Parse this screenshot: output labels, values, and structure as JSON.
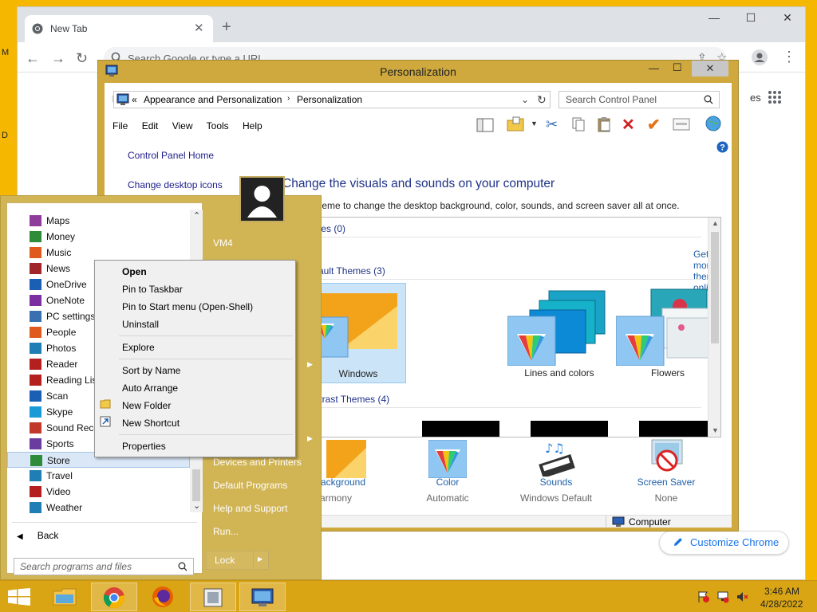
{
  "desktop": {
    "labels": [
      "M",
      "D"
    ]
  },
  "chrome": {
    "tab_title": "New Tab",
    "omnibox_placeholder": "Search Google or type a URL",
    "ntp_link_fragment": "es",
    "customize_label": "Customize Chrome"
  },
  "personalization": {
    "title": "Personalization",
    "breadcrumb": [
      "Appearance and Personalization",
      "Personalization"
    ],
    "breadcrumb_prefix": "«",
    "search_placeholder": "Search Control Panel",
    "menu": [
      "File",
      "Edit",
      "View",
      "Tools",
      "Help"
    ],
    "left_links": [
      "Control Panel Home",
      "Change desktop icons"
    ],
    "heading": "Change the visuals and sounds on your computer",
    "description": "Click a theme to change the desktop background, color, sounds, and screen saver all at once.",
    "my_themes_header": "hemes (0)",
    "get_more_link": "Get more themes online",
    "default_themes_header": "s Default Themes (3)",
    "themes": [
      "Windows",
      "Lines and colors",
      "Flowers"
    ],
    "high_contrast_header": "ontrast Themes (4)",
    "bottom": [
      {
        "label": "p Background",
        "sub": "armony"
      },
      {
        "label": "Color",
        "sub": "Automatic"
      },
      {
        "label": "Sounds",
        "sub": "Windows Default"
      },
      {
        "label": "Screen Saver",
        "sub": "None"
      }
    ],
    "status": "Computer"
  },
  "startmenu": {
    "programs": [
      {
        "label": "Maps",
        "color": "#8e3c9a"
      },
      {
        "label": "Money",
        "color": "#2e8b3a"
      },
      {
        "label": "Music",
        "color": "#e05a1e"
      },
      {
        "label": "News",
        "color": "#a0262a"
      },
      {
        "label": "OneDrive",
        "color": "#1a5fb4"
      },
      {
        "label": "OneNote",
        "color": "#7b2fa0"
      },
      {
        "label": "PC settings",
        "color": "#3a6fb0"
      },
      {
        "label": "People",
        "color": "#e05a1e"
      },
      {
        "label": "Photos",
        "color": "#1f7fb4"
      },
      {
        "label": "Reader",
        "color": "#b42020"
      },
      {
        "label": "Reading List",
        "color": "#b42020"
      },
      {
        "label": "Scan",
        "color": "#1a5fb4"
      },
      {
        "label": "Skype",
        "color": "#1a9ad6"
      },
      {
        "label": "Sound Recorder",
        "color": "#c0392b"
      },
      {
        "label": "Sports",
        "color": "#6a3ca0"
      },
      {
        "label": "Store",
        "color": "#2e8b3a"
      },
      {
        "label": "Travel",
        "color": "#1f7fb4"
      },
      {
        "label": "Video",
        "color": "#b42020"
      },
      {
        "label": "Weather",
        "color": "#1f7fb4"
      }
    ],
    "back_label": "Back",
    "search_placeholder": "Search programs and files",
    "user": "VM4",
    "right_items": [
      "Devices and Printers",
      "Default Programs",
      "Help and Support",
      "Run..."
    ],
    "lock_label": "Lock"
  },
  "context_menu": {
    "group1": [
      "Open",
      "Pin to Taskbar",
      "Pin to Start menu (Open-Shell)",
      "Uninstall"
    ],
    "group2": [
      "Explore"
    ],
    "group3": [
      "Sort by Name",
      "Auto Arrange",
      "New Folder",
      "New Shortcut"
    ],
    "group4": [
      "Properties"
    ]
  },
  "taskbar": {
    "time": "3:46 AM",
    "date": "4/28/2022"
  }
}
